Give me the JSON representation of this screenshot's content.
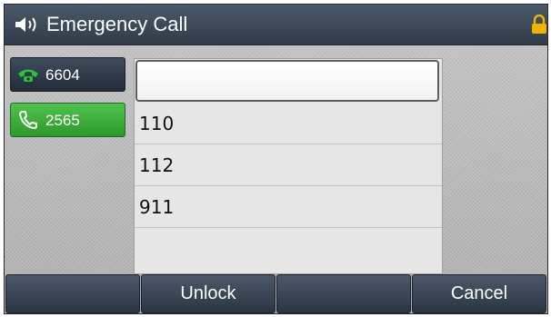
{
  "titlebar": {
    "title": "Emergency Call",
    "speaker_icon": "speaker-icon",
    "lock_icon": "lock-icon"
  },
  "line_keys": [
    {
      "label": "6604",
      "icon": "phone-handset-icon",
      "state": "idle"
    },
    {
      "label": "2565",
      "icon": "phone-call-icon",
      "state": "active"
    }
  ],
  "emergency_list": {
    "input_value": "",
    "items": [
      "110",
      "112",
      "911"
    ]
  },
  "softkeys": [
    "",
    "Unlock",
    "",
    "Cancel"
  ],
  "colors": {
    "title_bar": "#34404e",
    "active_line": "#3fae3b",
    "lock": "#f0b400",
    "phone_idle_icon": "#29c23a"
  }
}
